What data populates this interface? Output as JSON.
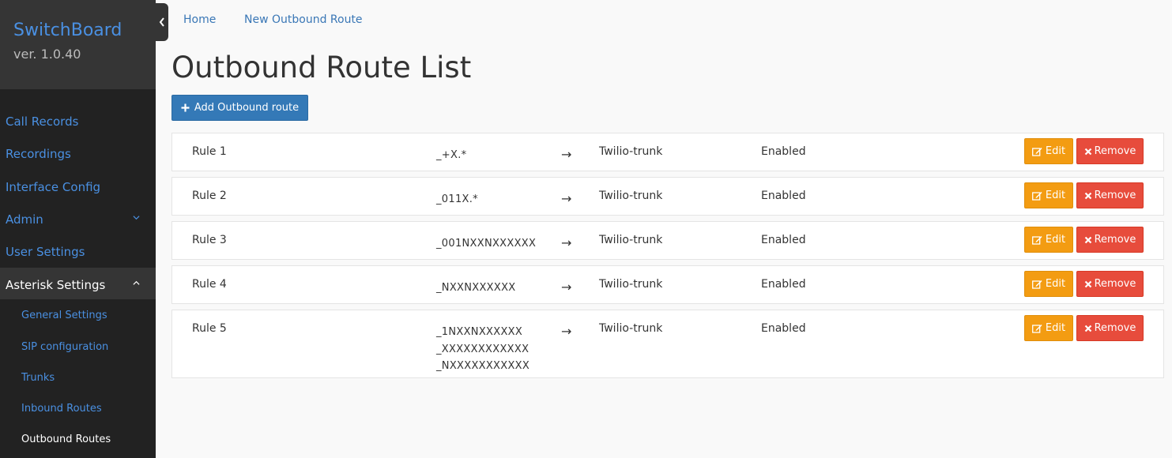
{
  "brand": {
    "name": "SwitchBoard",
    "version": "ver. 1.0.40"
  },
  "sidebar": {
    "items": [
      {
        "label": "Call Records"
      },
      {
        "label": "Recordings"
      },
      {
        "label": "Interface Config"
      },
      {
        "label": "Admin"
      },
      {
        "label": "User Settings"
      },
      {
        "label": "Asterisk Settings"
      }
    ],
    "subitems": [
      {
        "label": "General Settings"
      },
      {
        "label": "SIP configuration"
      },
      {
        "label": "Trunks"
      },
      {
        "label": "Inbound Routes"
      },
      {
        "label": "Outbound Routes"
      }
    ]
  },
  "breadcrumb": {
    "home": "Home",
    "current": "New Outbound Route"
  },
  "page": {
    "title": "Outbound Route List",
    "add_button": "Add Outbound route"
  },
  "routes": [
    {
      "name": "Rule 1",
      "patterns": [
        "_+X.*"
      ],
      "arrow": "→",
      "trunk": "Twilio-trunk",
      "status": "Enabled",
      "edit": "Edit",
      "remove": "Remove"
    },
    {
      "name": "Rule 2",
      "patterns": [
        "_011X.*"
      ],
      "arrow": "→",
      "trunk": "Twilio-trunk",
      "status": "Enabled",
      "edit": "Edit",
      "remove": "Remove"
    },
    {
      "name": "Rule 3",
      "patterns": [
        "_001NXXNXXXXXX"
      ],
      "arrow": "→",
      "trunk": "Twilio-trunk",
      "status": "Enabled",
      "edit": "Edit",
      "remove": "Remove"
    },
    {
      "name": "Rule 4",
      "patterns": [
        "_NXXNXXXXXX"
      ],
      "arrow": "→",
      "trunk": "Twilio-trunk",
      "status": "Enabled",
      "edit": "Edit",
      "remove": "Remove"
    },
    {
      "name": "Rule 5",
      "patterns": [
        "_1NXXNXXXXXX",
        "_XXXXXXXXXXXX",
        "_NXXXXXXXXXXX"
      ],
      "arrow": "→",
      "trunk": "Twilio-trunk",
      "status": "Enabled",
      "edit": "Edit",
      "remove": "Remove"
    }
  ],
  "colors": {
    "primary": "#3479b7",
    "warning": "#f39c12",
    "danger": "#e74c3c",
    "sidebar": "#222222",
    "link": "#4a90e2"
  },
  "icons": {
    "collapse": "chevron-left-icon",
    "admin_toggle": "chevron-down-icon",
    "asterisk_toggle": "chevron-up-icon",
    "add": "plus-icon",
    "edit": "edit-icon",
    "remove": "times-icon"
  }
}
